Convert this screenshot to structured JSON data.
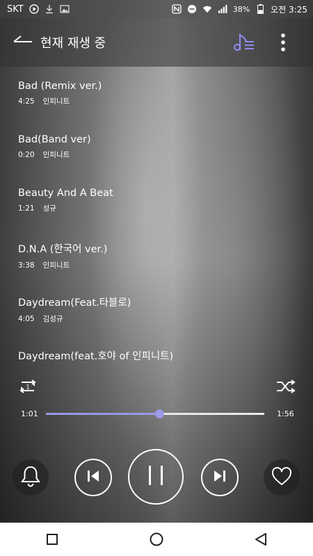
{
  "status_bar": {
    "carrier": "SKT",
    "battery": "38%",
    "time": "오전 3:25"
  },
  "header": {
    "title": "현재 재생 중"
  },
  "playlist": [
    {
      "title": "Bad (Remix ver.)",
      "duration": "4:25",
      "artist": "인피니트"
    },
    {
      "title": "Bad(Band ver)",
      "duration": "0:20",
      "artist": "인피니트"
    },
    {
      "title": "Beauty And A Beat",
      "duration": "1:21",
      "artist": "성규"
    },
    {
      "title": "D.N.A (한국어 ver.)",
      "duration": "3:38",
      "artist": "인피니트"
    },
    {
      "title": "Daydream(Feat.타블로)",
      "duration": "4:05",
      "artist": "김성규"
    },
    {
      "title": "Daydream(feat.호야 of 인피니트)",
      "duration": "",
      "artist": ""
    }
  ],
  "player": {
    "current_time": "1:01",
    "total_time": "1:56",
    "progress": 0.52,
    "repeat_mode": "1",
    "state": "playing"
  },
  "colors": {
    "accent": "#9d9ae8",
    "queue_icon": "#8f8cf0",
    "navbar_bg": "#ffffff"
  },
  "icons": [
    "back-arrow-icon",
    "playlist-queue-icon",
    "more-vert-icon",
    "repeat-one-icon",
    "shuffle-icon",
    "bell-icon",
    "previous-icon",
    "pause-icon",
    "next-icon",
    "heart-icon",
    "square-icon",
    "circle-icon",
    "triangle-back-icon"
  ]
}
